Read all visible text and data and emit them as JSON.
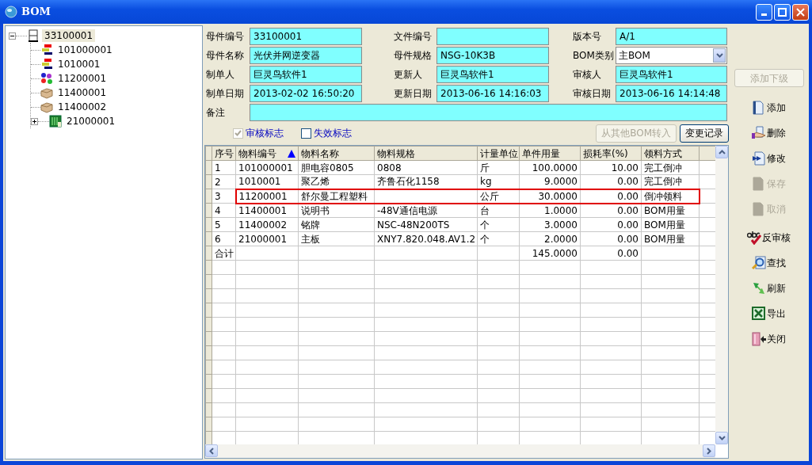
{
  "window": {
    "title": "BOM"
  },
  "tree": [
    {
      "label": "33100001",
      "kind": "doc",
      "selected": true,
      "expanded": true,
      "children": [
        {
          "label": "101000001",
          "kind": "bars",
          "selected": false
        },
        {
          "label": "1010001",
          "kind": "bars",
          "selected": false
        },
        {
          "label": "11200001",
          "kind": "blobs",
          "selected": false
        },
        {
          "label": "11400001",
          "kind": "box",
          "selected": false
        },
        {
          "label": "11400002",
          "kind": "box",
          "selected": false
        },
        {
          "label": "21000001",
          "kind": "board",
          "selected": false,
          "expanded": false
        }
      ]
    }
  ],
  "form": {
    "fields": [
      {
        "label": "母件编号",
        "value": "33100001",
        "kind": "text"
      },
      {
        "label": "文件编号",
        "kind": "text"
      },
      {
        "label": "版本号",
        "value": "A/1",
        "kind": "text"
      },
      {
        "label": "母件名称",
        "value": "光伏并网逆变器",
        "kind": "text"
      },
      {
        "label": "母件规格",
        "value": "NSG-10K3B",
        "kind": "text"
      },
      {
        "label": "BOM类别",
        "value": "主BOM",
        "kind": "select"
      },
      {
        "label": "制单人",
        "value": "巨灵鸟软件1",
        "kind": "text"
      },
      {
        "label": "更新人",
        "value": "巨灵鸟软件1",
        "kind": "text"
      },
      {
        "label": "审核人",
        "value": "巨灵鸟软件1",
        "kind": "text"
      },
      {
        "label": "制单日期",
        "value": "2013-02-02 16:50:20",
        "kind": "text"
      },
      {
        "label": "更新日期",
        "value": "2013-06-16 14:16:03",
        "kind": "text"
      },
      {
        "label": "审核日期",
        "value": "2013-06-16 14:14:48",
        "kind": "text"
      }
    ],
    "remark": {
      "label": "备注"
    },
    "checkboxes": [
      {
        "label": "审核标志",
        "checked": true,
        "disabled": true
      },
      {
        "label": "失效标志",
        "checked": false,
        "disabled": false
      }
    ],
    "buttons": [
      {
        "label": "从其他BOM转入",
        "disabled": true
      },
      {
        "label": "变更记录",
        "disabled": false
      }
    ]
  },
  "table": {
    "columns": [
      {
        "label": "序号",
        "kind": "text",
        "sorted": false
      },
      {
        "label": "物料编号",
        "kind": "text",
        "sorted": true
      },
      {
        "label": "物料名称",
        "kind": "text",
        "sorted": false
      },
      {
        "label": "物料规格",
        "kind": "text",
        "sorted": false
      },
      {
        "label": "计量单位",
        "kind": "text",
        "sorted": false
      },
      {
        "label": "单件用量",
        "kind": "number",
        "sorted": false
      },
      {
        "label": "损耗率(%)",
        "kind": "number",
        "sorted": false
      },
      {
        "label": "领料方式",
        "kind": "text",
        "sorted": false
      }
    ],
    "rows": [
      {
        "cells": [
          "1",
          "101000001",
          "胆电容0805",
          "0808",
          "斤",
          "100.0000",
          "10.00",
          "完工倒冲"
        ],
        "highlighted": false
      },
      {
        "cells": [
          "2",
          "1010001",
          "聚乙烯",
          "齐鲁石化1158",
          "kg",
          "9.0000",
          "0.00",
          "完工倒冲"
        ],
        "highlighted": false
      },
      {
        "cells": [
          "3",
          "11200001",
          "舒尔曼工程塑料",
          "",
          "公斤",
          "30.0000",
          "0.00",
          "倒冲领料"
        ],
        "highlighted": true
      },
      {
        "cells": [
          "4",
          "11400001",
          "说明书",
          "-48V通信电源",
          "台",
          "1.0000",
          "0.00",
          "BOM用量"
        ],
        "highlighted": false
      },
      {
        "cells": [
          "5",
          "11400002",
          "铭牌",
          "NSC-48N200TS",
          "个",
          "3.0000",
          "0.00",
          "BOM用量"
        ],
        "highlighted": false
      },
      {
        "cells": [
          "6",
          "21000001",
          "主板",
          "XNY7.820.048.AV1.2",
          "个",
          "2.0000",
          "0.00",
          "BOM用量"
        ],
        "highlighted": false
      }
    ],
    "total": {
      "cells": [
        "合计",
        "",
        "",
        "",
        "",
        "145.0000",
        "0.00",
        ""
      ]
    }
  },
  "toolbar": {
    "add_child": {
      "label": "添加下级",
      "disabled": true
    },
    "buttons": [
      {
        "label": "添加",
        "kind": "page",
        "disabled": false
      },
      {
        "label": "删除",
        "kind": "hand",
        "disabled": false
      },
      {
        "label": "修改",
        "kind": "edit",
        "disabled": false
      },
      {
        "label": "保存",
        "kind": "page",
        "disabled": true
      },
      {
        "label": "取消",
        "kind": "page",
        "disabled": true
      },
      {
        "label": "反审核",
        "kind": "abc",
        "disabled": false
      },
      {
        "label": "查找",
        "kind": "find",
        "disabled": false
      },
      {
        "label": "刷新",
        "kind": "refresh",
        "disabled": false
      },
      {
        "label": "导出",
        "kind": "sheet",
        "disabled": false
      },
      {
        "label": "关闭",
        "kind": "door",
        "disabled": false
      }
    ]
  }
}
